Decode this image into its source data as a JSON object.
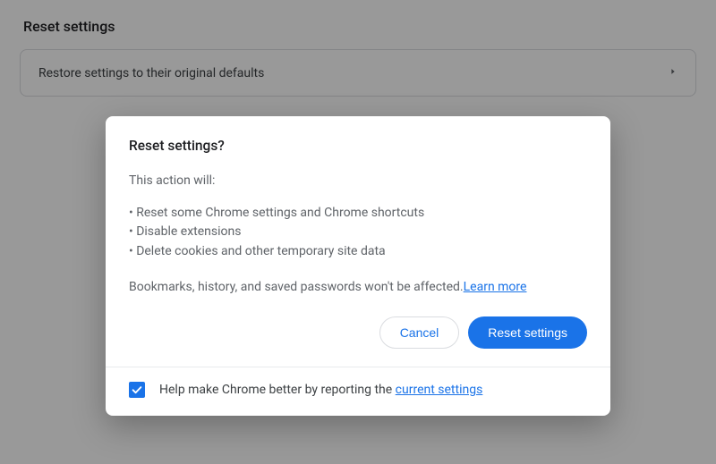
{
  "section": {
    "title": "Reset settings",
    "row_label": "Restore settings to their original defaults"
  },
  "dialog": {
    "title": "Reset settings?",
    "intro": "This action will:",
    "bullets": [
      "• Reset some Chrome settings and Chrome shortcuts",
      "• Disable extensions",
      "• Delete cookies and other temporary site data"
    ],
    "footnote": "Bookmarks, history, and saved passwords won't be affected.",
    "learn_more": "Learn more",
    "cancel_label": "Cancel",
    "reset_label": "Reset settings",
    "footer_prefix": "Help make Chrome better by reporting the ",
    "footer_link": "current settings",
    "checkbox_checked": true
  }
}
